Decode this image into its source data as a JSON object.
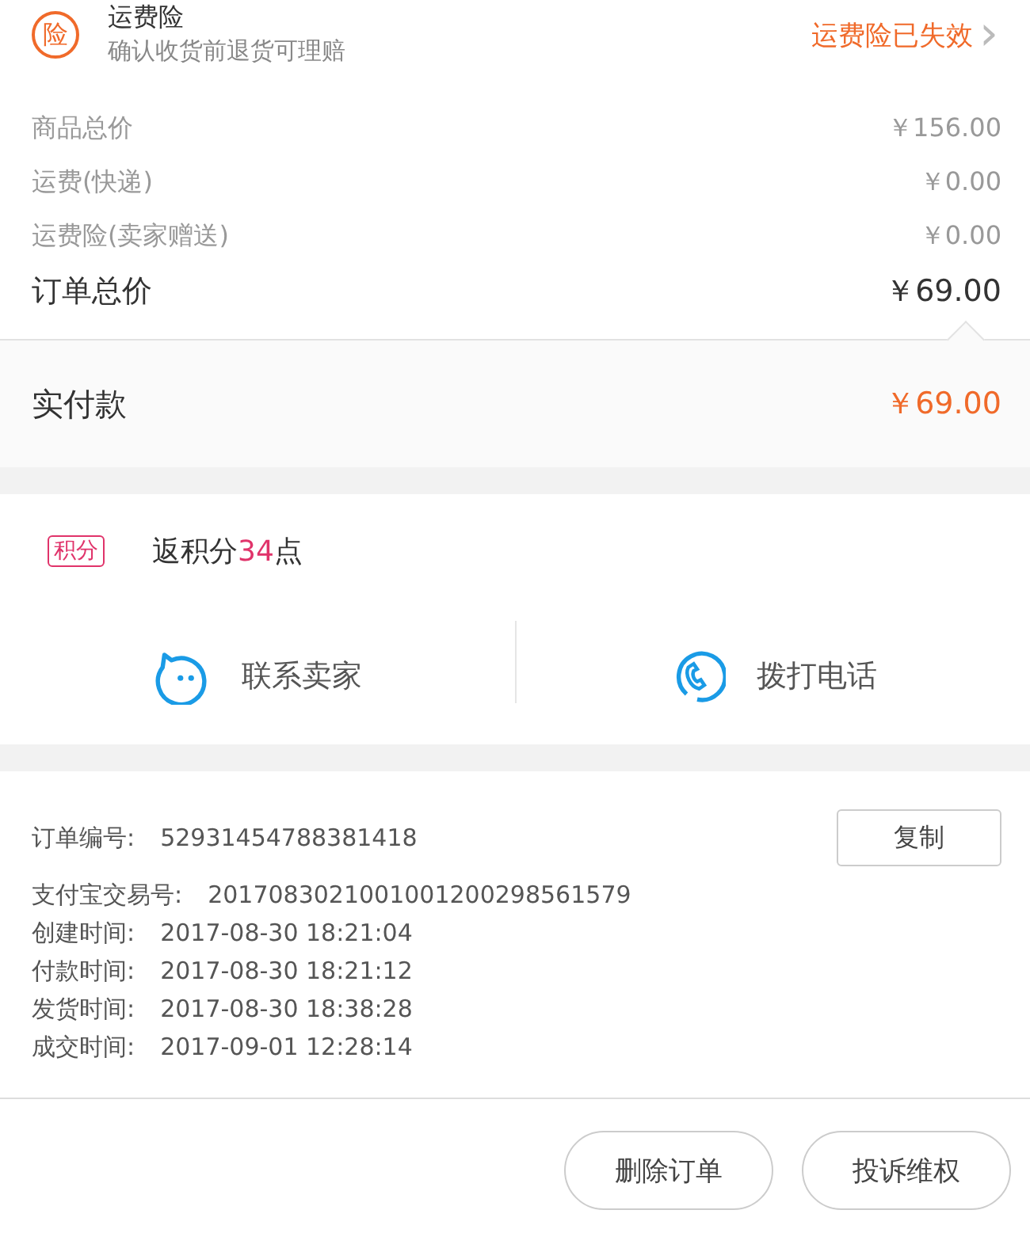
{
  "insurance": {
    "badge": "险",
    "title": "运费险",
    "subtitle": "确认收货前退货可理赔",
    "status": "运费险已失效",
    "chevron": "›"
  },
  "prices": [
    {
      "label": "商品总价",
      "value": "￥156.00",
      "kind": "minor"
    },
    {
      "label": "运费(快递)",
      "value": "￥0.00",
      "kind": "minor"
    },
    {
      "label": "运费险(卖家赠送)",
      "value": "￥0.00",
      "kind": "minor"
    },
    {
      "label": "订单总价",
      "value": "￥69.00",
      "kind": "total"
    }
  ],
  "paid": {
    "label": "实付款",
    "value": "￥69.00"
  },
  "points": {
    "tag": "积分",
    "text": "返积分**34**点"
  },
  "contacts": [
    {
      "label": "联系卖家",
      "kind": "chat"
    },
    {
      "label": "拨打电话",
      "kind": "phone"
    }
  ],
  "order_info": {
    "copy_button": "复制",
    "rows": [
      {
        "label": "订单编号:",
        "value": "52931454788381418"
      },
      {
        "label": "支付宝交易号:",
        "value": "2017083021001001200298561579"
      },
      {
        "label": "创建时间:",
        "value": "2017-08-30 18:21:04"
      },
      {
        "label": "付款时间:",
        "value": "2017-08-30 18:21:12"
      },
      {
        "label": "发货时间:",
        "value": "2017-08-30 18:38:28"
      },
      {
        "label": "成交时间:",
        "value": "2017-09-01 12:28:14"
      }
    ]
  },
  "actions": [
    "删除订单",
    "投诉维权"
  ]
}
